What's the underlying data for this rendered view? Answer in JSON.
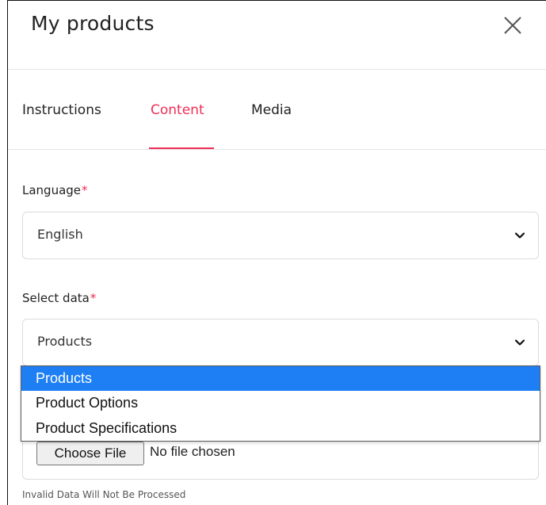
{
  "header": {
    "title": "My products"
  },
  "tabs": [
    {
      "label": "Instructions",
      "active": false
    },
    {
      "label": "Content",
      "active": true
    },
    {
      "label": "Media",
      "active": false
    }
  ],
  "form": {
    "language": {
      "label": "Language",
      "required_mark": "*",
      "value": "English"
    },
    "select_data": {
      "label": "Select data",
      "required_mark": "*",
      "value": "Products",
      "options": [
        "Products",
        "Product Options",
        "Product Specifications"
      ],
      "highlighted_option": "Products"
    },
    "file": {
      "button_label": "Choose File",
      "status": "No file chosen"
    },
    "hint": "Invalid Data Will Not Be Processed"
  },
  "colors": {
    "accent": "#ef2e55",
    "option_highlight": "#1e7ff5"
  },
  "icons": {
    "close": "close-icon",
    "chevron": "chevron-down-icon"
  }
}
